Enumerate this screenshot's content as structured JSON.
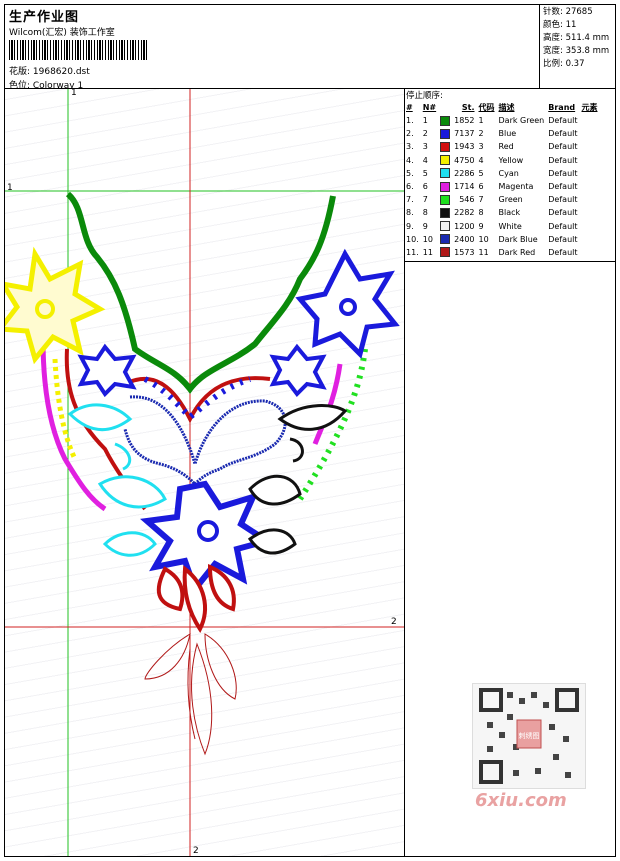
{
  "header": {
    "title": "生产作业图",
    "company": "Wilcom(汇宏) 装饰工作室",
    "design_label": "花版: 1968620.dst",
    "colorway_label": "色位: Colorway 1"
  },
  "stats": {
    "stitches": "针数: 27685",
    "colors": "颜色: 11",
    "height": "高度: 511.4 mm",
    "width": "宽度: 353.8 mm",
    "scale": "比例: 0.37"
  },
  "stop_sequence": {
    "title": "停止顺序:",
    "columns": [
      "#",
      "N#",
      "St.",
      "代码",
      "描述",
      "Brand",
      "元素"
    ],
    "rows": [
      {
        "num": "1.",
        "n": "1",
        "st": "1852",
        "code": "1",
        "desc": "Dark Green",
        "brand": "Default",
        "color": "#0a8a0a"
      },
      {
        "num": "2.",
        "n": "2",
        "st": "7137",
        "code": "2",
        "desc": "Blue",
        "brand": "Default",
        "color": "#1a1adc"
      },
      {
        "num": "3.",
        "n": "3",
        "st": "1943",
        "code": "3",
        "desc": "Red",
        "brand": "Default",
        "color": "#d01010"
      },
      {
        "num": "4.",
        "n": "4",
        "st": "4750",
        "code": "4",
        "desc": "Yellow",
        "brand": "Default",
        "color": "#f4f000"
      },
      {
        "num": "5.",
        "n": "5",
        "st": "2286",
        "code": "5",
        "desc": "Cyan",
        "brand": "Default",
        "color": "#20e0f0"
      },
      {
        "num": "6.",
        "n": "6",
        "st": "1714",
        "code": "6",
        "desc": "Magenta",
        "brand": "Default",
        "color": "#e020e0"
      },
      {
        "num": "7.",
        "n": "7",
        "st": "546",
        "code": "7",
        "desc": "Green",
        "brand": "Default",
        "color": "#20e020"
      },
      {
        "num": "8.",
        "n": "8",
        "st": "2282",
        "code": "8",
        "desc": "Black",
        "brand": "Default",
        "color": "#111111"
      },
      {
        "num": "9.",
        "n": "9",
        "st": "1200",
        "code": "9",
        "desc": "White",
        "brand": "Default",
        "color": "#f4f4f4"
      },
      {
        "num": "10.",
        "n": "10",
        "st": "2400",
        "code": "10",
        "desc": "Dark Blue",
        "brand": "Default",
        "color": "#1a2ab0"
      },
      {
        "num": "11.",
        "n": "11",
        "st": "1573",
        "code": "11",
        "desc": "Dark Red",
        "brand": "Default",
        "color": "#b01818"
      }
    ]
  },
  "axis_labels": {
    "top_v": "1",
    "left_h": "1",
    "right_h": "2",
    "bottom_v": "2"
  },
  "watermark": "6xiu.com",
  "qr_stamp": "刺绣图"
}
